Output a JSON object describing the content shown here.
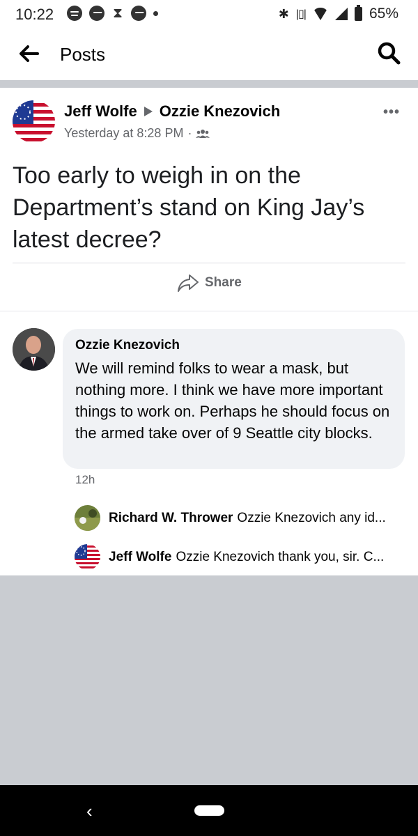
{
  "status_bar": {
    "time": "10:22",
    "battery_percent": "65%",
    "icons": [
      "spotify-icon",
      "messenger-icon",
      "hourglass-icon",
      "messenger-icon",
      "dot-icon",
      "bluetooth-icon",
      "vibrate-icon",
      "wifi-icon",
      "signal-icon",
      "battery-icon"
    ]
  },
  "header": {
    "title": "Posts",
    "back_icon": "arrow-left-icon",
    "search_icon": "search-icon"
  },
  "post": {
    "author": "Jeff Wolfe",
    "target": "Ozzie Knezovich",
    "timestamp": "Yesterday at 8:28 PM",
    "separator": "·",
    "audience_icon": "group-icon",
    "text": "Too early to weigh in on the Department’s stand on King Jay’s latest decree?",
    "share_label": "Share"
  },
  "comment": {
    "author": "Ozzie Knezovich",
    "text": "We will remind folks to wear a mask, but nothing more. I think we have more important things to work on. Perhaps he should focus on the armed take over of 9 Seattle city blocks.",
    "time": "12h"
  },
  "replies": [
    {
      "author": "Richard W. Thrower",
      "snippet": "Ozzie Knezovich any id..."
    },
    {
      "author": "Jeff Wolfe",
      "snippet": "Ozzie Knezovich thank you, sir. C..."
    }
  ],
  "nav": {
    "back_glyph": "‹"
  },
  "colors": {
    "meta_gray": "#65676b",
    "bubble_bg": "#f0f2f5",
    "feed_bg": "#c9ccd1",
    "flag_red": "#c8102e",
    "flag_blue": "#1f3a93"
  }
}
